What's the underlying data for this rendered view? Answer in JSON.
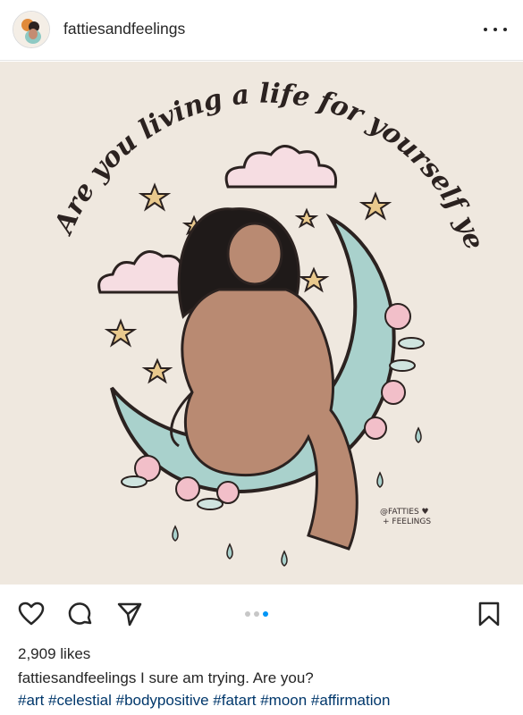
{
  "post": {
    "username": "fattiesandfeelings",
    "more_icon": "more-options-icon",
    "image": {
      "headline": "Are you living a life for yourself yet?",
      "signature_line1": "@FATTIES ♥",
      "signature_line2": "+ FEELINGS"
    },
    "carousel": {
      "count": 3,
      "active_index": 3
    },
    "likes": "2,909 likes",
    "caption_user": "fattiesandfeelings",
    "caption_text": " I sure am trying. Are you?",
    "hashtags": "#art #celestial #bodypositive #fatart #moon #affirmation"
  },
  "colors": {
    "accent_blue": "#0095f6",
    "hashtag_blue": "#00376b",
    "image_background": "#efe8df",
    "moon": "#a9d1cc",
    "flower_pink": "#f2bfc9"
  }
}
